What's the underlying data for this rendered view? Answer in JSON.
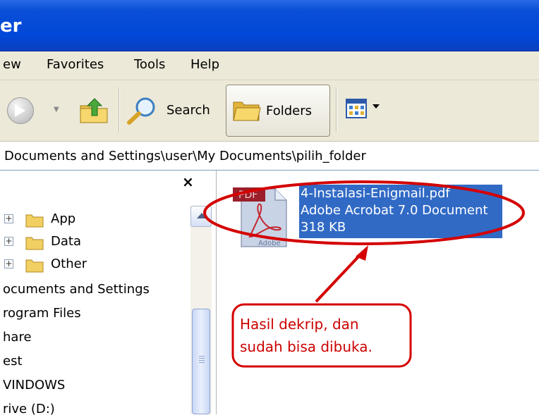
{
  "window": {
    "title_fragment": "er"
  },
  "menu": {
    "items": [
      "ew",
      "Favorites",
      "Tools",
      "Help"
    ]
  },
  "toolbar": {
    "search_label": "Search",
    "folders_label": "Folders"
  },
  "address": {
    "path": "Documents and Settings\\user\\My Documents\\pilih_folder"
  },
  "folder_pane": {
    "close_glyph": "×",
    "items": [
      {
        "label": "App",
        "expander": "+"
      },
      {
        "label": "Data",
        "expander": "+"
      },
      {
        "label": "Other",
        "expander": "+"
      },
      {
        "label": "ocuments and Settings"
      },
      {
        "label": "rogram Files"
      },
      {
        "label": "hare"
      },
      {
        "label": "est"
      },
      {
        "label": "VINDOWS"
      },
      {
        "label": "rive (D:)"
      }
    ]
  },
  "file": {
    "icon_text": "PDF",
    "icon_brand": "Adobe",
    "name": "4-Instalasi-Enigmail.pdf",
    "type": "Adobe Acrobat 7.0 Document",
    "size": "318 KB"
  },
  "annotation": {
    "callout_line1": "Hasil dekrip, dan",
    "callout_line2": "sudah bisa dibuka.",
    "color": "#d40000"
  }
}
